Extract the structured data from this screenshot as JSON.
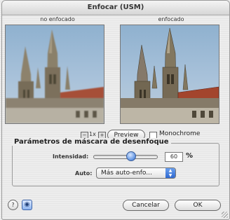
{
  "window": {
    "title": "Enfocar (USM)"
  },
  "previews": {
    "left_caption": "no enfocado",
    "right_caption": "enfocado"
  },
  "zoom": {
    "label": "1x"
  },
  "toolbar": {
    "preview_label": "Preview",
    "monochrome_label": "Monochrome",
    "monochrome_checked": false
  },
  "params": {
    "group_title": "Parámetros de máscara de desenfoque",
    "intensity_label": "Intensidad:",
    "intensity_value": "60",
    "intensity_unit": "%",
    "intensity_level": 0.6,
    "auto_label": "Auto:",
    "auto_selected": "Más auto-enfo..."
  },
  "buttons": {
    "cancel_label": "Cancelar",
    "ok_label": "OK"
  },
  "icons": {
    "help": "help-icon",
    "compare": "compare-icon"
  },
  "colors": {
    "sky": "#9fbcd6",
    "spire": "#8a7f6a",
    "roof": "#a24c37",
    "accent": "#3a6bc6"
  }
}
